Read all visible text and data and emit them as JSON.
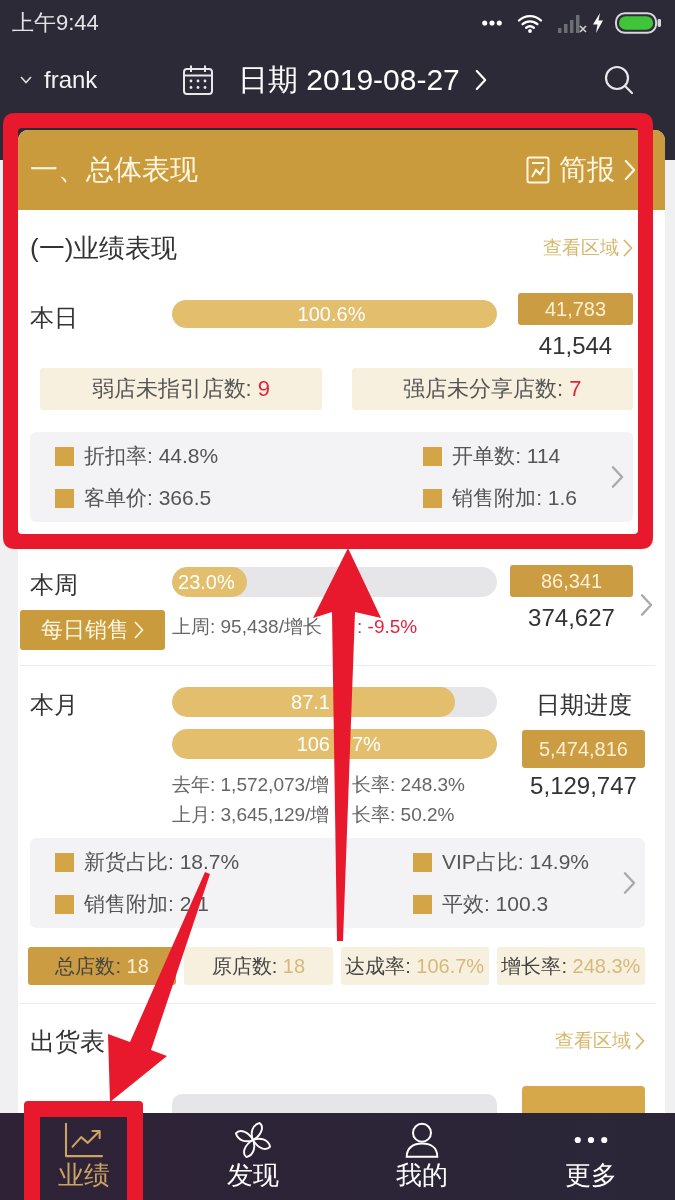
{
  "status_bar": {
    "time": "上午9:44"
  },
  "header": {
    "user": "frank",
    "date": "日期 2019-08-27"
  },
  "overview": {
    "title": "一、总体表现",
    "report_link": "简报",
    "sales": {
      "title": "(一)业绩表现",
      "region_link": "查看区域",
      "periods": [
        {
          "kind": "day",
          "label": "本日",
          "bars": [
            {
              "text": "100.6%",
              "level": 1
            }
          ],
          "target": "41,783",
          "actual": "41,544",
          "store_counts": [
            {
              "label": "弱店未指引店数:",
              "value": "9"
            },
            {
              "label": "强店未分享店数:",
              "value": "7"
            }
          ],
          "metrics": [
            {
              "text": "折扣率: 44.8%"
            },
            {
              "text": "开单数: 114"
            },
            {
              "text": "客单价: 366.5"
            },
            {
              "text": "销售附加: 1.6"
            }
          ]
        },
        {
          "kind": "week",
          "label": "本周",
          "button": "每日销售",
          "bars": [
            {
              "text": "23.0%",
              "level": 0.23
            }
          ],
          "comparisons": [
            {
              "text": "上周: 95,438/增长",
              "text_after": ":",
              "change": "-9.5%",
              "negative": true
            }
          ],
          "target": "86,341",
          "actual": "374,627"
        },
        {
          "kind": "month",
          "label": "本月",
          "bars": [
            {
              "text": "87.1",
              "level": 0.871
            },
            {
              "text": "106",
              "text_after": "7%",
              "level": 1
            }
          ],
          "comparisons": [
            {
              "text": "去年: 1,572,073/增",
              "text_after": "长率:",
              "change": "248.3%",
              "negative": false
            },
            {
              "text": "上月: 3,645,129/增",
              "text_after": "长率:",
              "change": "50.2%",
              "negative": false
            }
          ],
          "side_label": "日期进度",
          "target": "5,474,816",
          "actual": "5,129,747",
          "metrics": [
            {
              "text": "新货占比: 18.7%"
            },
            {
              "text": "VIP占比: 14.9%"
            },
            {
              "text": "销售附加: 2.1"
            },
            {
              "text": "平效: 100.3"
            }
          ],
          "summary": [
            {
              "label": "总店数:",
              "value": "18",
              "selected": true
            },
            {
              "label": "原店数:",
              "value": "18",
              "selected": false
            },
            {
              "label": "达成率:",
              "value": "106.7%",
              "selected": false
            },
            {
              "label": "增长率:",
              "value": "248.3%",
              "selected": false
            }
          ]
        }
      ]
    },
    "shipping": {
      "title": "出货表",
      "region_link": "查看区域",
      "bars": [
        {
          "level": 0
        }
      ]
    }
  },
  "tabs": [
    {
      "label": "业绩",
      "selected": true
    },
    {
      "label": "发现",
      "selected": false
    },
    {
      "label": "我的",
      "selected": false
    },
    {
      "label": "更多",
      "selected": false
    }
  ]
}
